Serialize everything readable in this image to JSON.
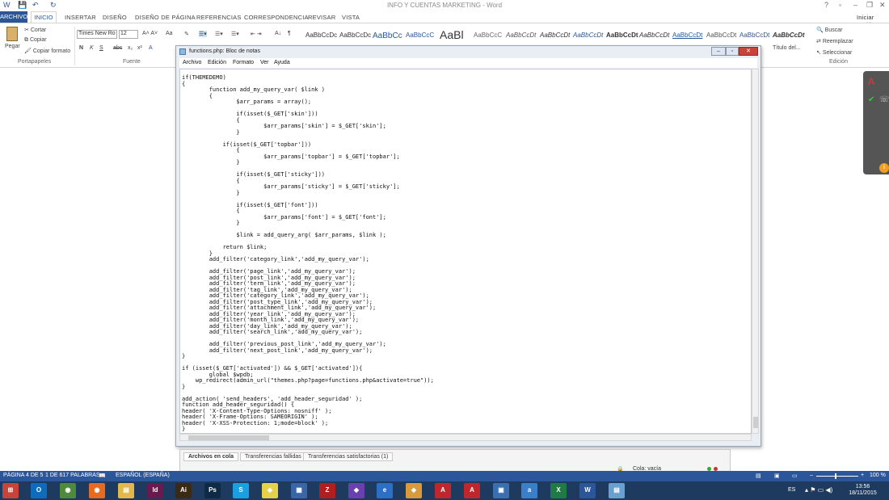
{
  "word": {
    "title": "INFO Y CUENTAS MARKETING - Word",
    "signin": "Iniciar sesión",
    "tabs": [
      "ARCHIVO",
      "INICIO",
      "INSERTAR",
      "DISEÑO",
      "DISEÑO DE PÁGINA",
      "REFERENCIAS",
      "CORRESPONDENCIA",
      "REVISAR",
      "VISTA"
    ],
    "clipboard": {
      "paste": "Pegar",
      "cut": "Cortar",
      "copy": "Copiar",
      "format": "Copiar formato",
      "label": "Portapapeles"
    },
    "font": {
      "name": "Times New Ro",
      "size": "12",
      "label": "Fuente"
    },
    "styles": [
      "AaBbCcDc",
      "AaBbCcDc",
      "AaBbCc",
      "AaBbCcC",
      "AaBl",
      "AaBbCcC",
      "AaBbCcDt",
      "AaBbCcDt",
      "AaBbCcDt",
      "AaBbCcDt",
      "AaBbCcDt",
      "AaBbCcDt",
      "AaBbCcDt",
      "AaBbCcDt",
      "AaBbCcDt"
    ],
    "style_title": "Título del...",
    "editing": {
      "find": "Buscar",
      "replace": "Reemplazar",
      "select": "Seleccionar",
      "label": "Edición"
    },
    "status": {
      "page": "PÁGINA 4 DE 5",
      "words": "1 DE 617 PALABRAS",
      "lang": "ESPAÑOL (ESPAÑA)",
      "zoom": "100 %"
    }
  },
  "notepad": {
    "title": "functions.php: Bloc de notas",
    "menu": [
      "Archivo",
      "Edición",
      "Formato",
      "Ver",
      "Ayuda"
    ],
    "code": "if(THEMEDEMO)\n{\n        function add_my_query_var( $link )\n        {\n                $arr_params = array();\n\n                if(isset($_GET['skin']))\n                {\n                        $arr_params['skin'] = $_GET['skin'];\n                }\n\n            if(isset($_GET['topbar']))\n                {\n                        $arr_params['topbar'] = $_GET['topbar'];\n                }\n\n                if(isset($_GET['sticky']))\n                {\n                        $arr_params['sticky'] = $_GET['sticky'];\n                }\n\n                if(isset($_GET['font']))\n                {\n                        $arr_params['font'] = $_GET['font'];\n                }\n\n                $link = add_query_arg( $arr_params, $link );\n\n            return $link;\n        }\n        add_filter('category_link','add_my_query_var');\n\n        add_filter('page_link','add_my_query_var');\n        add_filter('post_link','add_my_query_var');\n        add_filter('term_link','add_my_query_var');\n        add_filter('tag_link','add_my_query_var');\n        add_filter('category_link','add_my_query_var');\n        add_filter('post_type_link','add_my_query_var');\n        add_filter('attachment_link','add_my_query_var');\n        add_filter('year_link','add_my_query_var');\n        add_filter('month_link','add_my_query_var');\n        add_filter('day_link','add_my_query_var');\n        add_filter('search_link','add_my_query_var');\n\n        add_filter('previous_post_link','add_my_query_var');\n        add_filter('next_post_link','add_my_query_var');\n}\n\nif (isset($_GET['activated']) && $_GET['activated']){\n        global $wpdb;\n    wp_redirect(admin_url(\"themes.php?page=functions.php&activate=true\"));\n}\n\nadd_action( 'send_headers', 'add_header_seguridad' );\nfunction add_header_seguridad() {\nheader( 'X-Content-Type-Options: nosniff' );\nheader( 'X-Frame-Options: SAMEORIGIN' );\nheader( 'X-XSS-Protection: 1;mode=block' );\n}"
  },
  "queue": {
    "tabs": [
      "Archivos en cola",
      "Transferencias fallidas",
      "Transferencias satisfactorias (1)"
    ],
    "status": "Cola: vacía"
  },
  "taskbar": {
    "time": "13:56",
    "date": "18/11/2015",
    "lang": "ES",
    "apps": [
      {
        "name": "start-icon",
        "color": "#c7443a",
        "txt": "⊞"
      },
      {
        "name": "outlook-icon",
        "color": "#0f6cbd",
        "txt": "O"
      },
      {
        "name": "chrome-icon",
        "color": "#4f8a3c",
        "txt": "◉"
      },
      {
        "name": "firefox-icon",
        "color": "#e66a1f",
        "txt": "◉"
      },
      {
        "name": "explorer-icon",
        "color": "#e3b84a",
        "txt": "▤"
      },
      {
        "name": "indesign-icon",
        "color": "#6b1a4f",
        "txt": "Id"
      },
      {
        "name": "illustrator-icon",
        "color": "#3b2a12",
        "txt": "Ai"
      },
      {
        "name": "photoshop-icon",
        "color": "#0e2a47",
        "txt": "Ps"
      },
      {
        "name": "skype-icon",
        "color": "#1aa0e2",
        "txt": "S"
      },
      {
        "name": "folder-icon",
        "color": "#e6d24a",
        "txt": "◆"
      },
      {
        "name": "utility-icon",
        "color": "#3a66a8",
        "txt": "▦"
      },
      {
        "name": "filezilla-icon",
        "color": "#b01e1e",
        "txt": "Z"
      },
      {
        "name": "tool-icon",
        "color": "#6a3fb0",
        "txt": "◆"
      },
      {
        "name": "ie-icon",
        "color": "#2b6fc7",
        "txt": "e"
      },
      {
        "name": "misc-icon",
        "color": "#d89a3a",
        "txt": "◆"
      },
      {
        "name": "acrobat-icon",
        "color": "#c0272d",
        "txt": "A"
      },
      {
        "name": "acrobat-pro-icon",
        "color": "#c0272d",
        "txt": "A"
      },
      {
        "name": "network-icon",
        "color": "#3a6fb0",
        "txt": "▣"
      },
      {
        "name": "app-a-icon",
        "color": "#3a7fc7",
        "txt": "a"
      },
      {
        "name": "excel-icon",
        "color": "#1f7a45",
        "txt": "X"
      },
      {
        "name": "word-icon",
        "color": "#2b579a",
        "txt": "W"
      },
      {
        "name": "notepad-icon",
        "color": "#6aa0d0",
        "txt": "▤"
      }
    ]
  }
}
